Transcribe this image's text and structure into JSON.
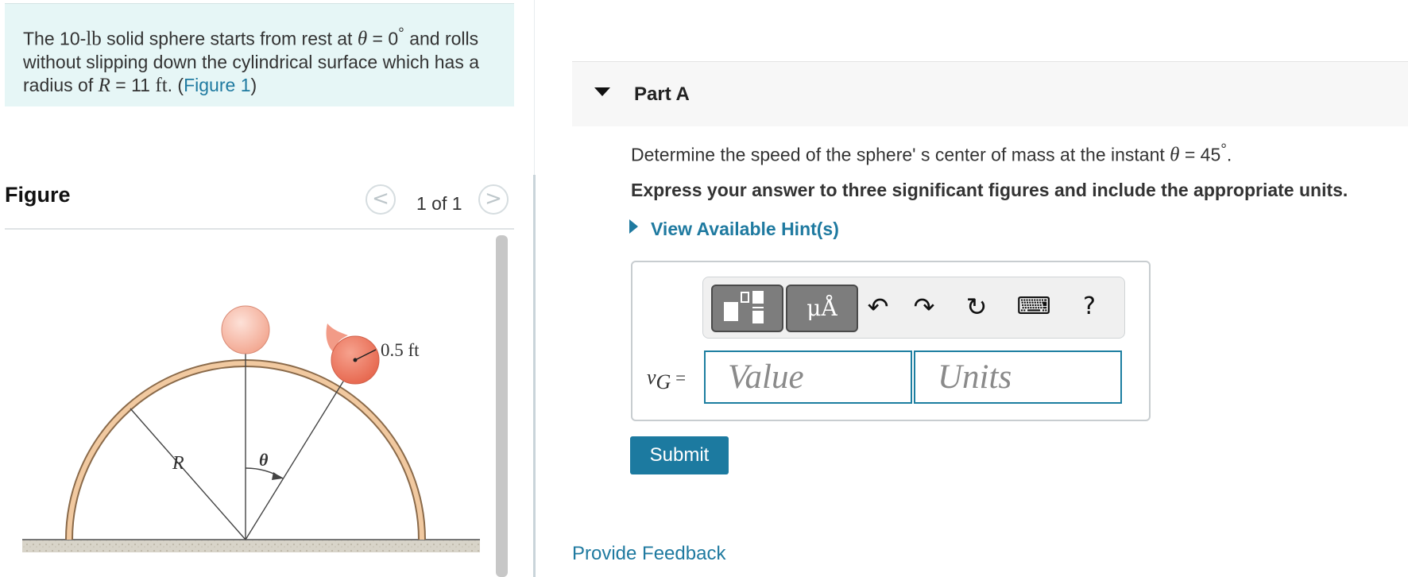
{
  "problem": {
    "text_1": "The 10-",
    "unit_lb": "lb",
    "text_2": " solid sphere starts from rest at ",
    "theta": "θ",
    "text_3": " = 0",
    "deg": "°",
    "text_4": " and rolls",
    "line2": "without slipping down the cylindrical surface which has a",
    "text_5": "radius of ",
    "R": "R",
    "text_6": " = 11 ",
    "unit_ft": "ft",
    "text_7": ". (",
    "figure_link": "Figure 1",
    "text_8": ")"
  },
  "figure": {
    "title": "Figure",
    "prev": "<",
    "next": ">",
    "counter": "1 of 1",
    "label_radius": "0.5 ft",
    "label_R": "R",
    "label_theta": "θ"
  },
  "part": {
    "title": "Part A",
    "question_1": "Determine the speed of the sphere'   s center of mass at the instant ",
    "question_theta": "θ",
    "question_2": " = 45",
    "question_deg": "°",
    "question_3": ".",
    "instruction": "Express your answer to three significant figures and include the appropriate units.",
    "hints": "View Available Hint(s)"
  },
  "toolbar": {
    "units_btn": "μÅ",
    "undo": "↶",
    "redo": "↷",
    "reset": "↻",
    "keyboard": "⌨",
    "help": "?"
  },
  "answer": {
    "label_v": "v",
    "label_sub": "G",
    "label_eq": " =",
    "value_placeholder": "Value",
    "units_placeholder": "Units",
    "value": "",
    "units": ""
  },
  "submit": "Submit",
  "feedback": "Provide Feedback"
}
